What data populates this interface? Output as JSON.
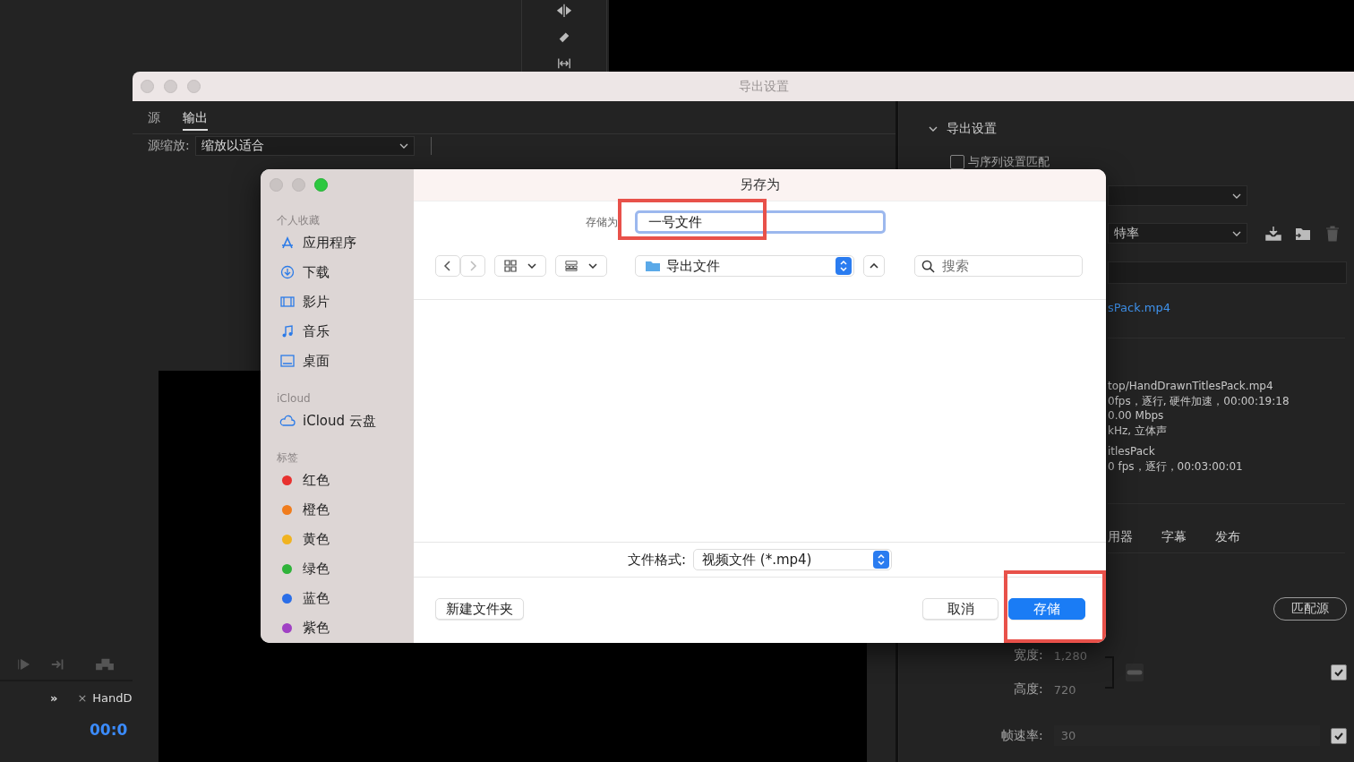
{
  "app": {
    "panel_tab": {
      "more": "»",
      "close": "×",
      "label": "HandD"
    },
    "timecode": "00:0"
  },
  "export_window": {
    "title": "导出设置",
    "tabs": [
      {
        "label": "源",
        "selected": false
      },
      {
        "label": "输出",
        "selected": true
      }
    ],
    "source_scale": {
      "label": "源缩放:",
      "value": "缩放以适合"
    },
    "settings": {
      "heading": "导出设置",
      "expanded": true,
      "match_sequence": {
        "label": "与序列设置匹配",
        "checked": false
      },
      "preset": {
        "value": "特率"
      },
      "output_name": "sPack.mp4",
      "output_summary": [
        "top/HandDrawnTitlesPack.mp4",
        "0fps，逐行, 硬件加速，00:00:19:18",
        "0.00 Mbps",
        "kHz, 立体声"
      ],
      "source_summary": [
        "itlesPack",
        "0 fps，逐行，00:03:00:01"
      ],
      "tabs": [
        {
          "label": "用器"
        },
        {
          "label": "字幕"
        },
        {
          "label": "发布"
        }
      ],
      "match_source": "匹配源",
      "width": {
        "label": "宽度:",
        "value": "1,280",
        "checked": true
      },
      "height": {
        "label": "高度:",
        "value": "720"
      },
      "frame_rate": {
        "label": "帧速率:",
        "value": "30",
        "checked": true
      }
    }
  },
  "dialog": {
    "title": "另存为",
    "sidebar": [
      {
        "heading": "个人收藏",
        "items": [
          {
            "label": "应用程序",
            "kind": "apps"
          },
          {
            "label": "下载",
            "kind": "download"
          },
          {
            "label": "影片",
            "kind": "movies"
          },
          {
            "label": "音乐",
            "kind": "music"
          },
          {
            "label": "桌面",
            "kind": "desktop"
          }
        ]
      },
      {
        "heading": "iCloud",
        "items": [
          {
            "label": "iCloud 云盘",
            "kind": "cloud"
          }
        ]
      },
      {
        "heading": "标签",
        "items": [
          {
            "label": "红色",
            "kind": "tag",
            "color": "#e8312f"
          },
          {
            "label": "橙色",
            "kind": "tag",
            "color": "#f07c1c"
          },
          {
            "label": "黄色",
            "kind": "tag",
            "color": "#f0b320"
          },
          {
            "label": "绿色",
            "kind": "tag",
            "color": "#2fb33a"
          },
          {
            "label": "蓝色",
            "kind": "tag",
            "color": "#2a6ee8"
          },
          {
            "label": "紫色",
            "kind": "tag",
            "color": "#a041c4"
          }
        ]
      }
    ],
    "save_as": {
      "label": "存储为",
      "value": "一号文件",
      "highlighted": true
    },
    "location": "导出文件",
    "search": {
      "placeholder": "搜索"
    },
    "format": {
      "label": "文件格式:",
      "value": "视频文件 (*.mp4)"
    },
    "new_folder": "新建文件夹",
    "cancel": "取消",
    "save": {
      "label": "存储",
      "highlighted": true
    }
  }
}
